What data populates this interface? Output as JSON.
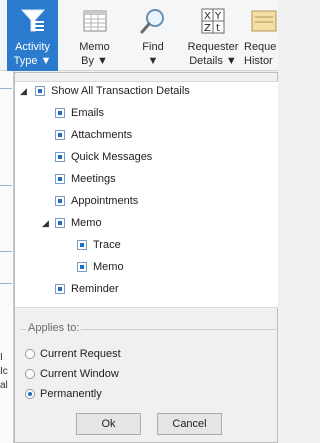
{
  "ribbon": {
    "buttons": [
      {
        "line1": "Activity",
        "line2": "Type ▼",
        "icon": "funnel-icon",
        "active": true
      },
      {
        "line1": "Memo",
        "line2": "By ▼",
        "icon": "memo-grid-icon"
      },
      {
        "line1": "Find",
        "line2": "▼",
        "icon": "magnifier-icon"
      },
      {
        "line1": "Requester",
        "line2": "Details ▼",
        "icon": "xyz-sort-icon"
      },
      {
        "line1": "Reque",
        "line2": "Histor",
        "icon": "history-icon"
      }
    ]
  },
  "background": {
    "texts": [
      "I",
      "Ic",
      "al"
    ]
  },
  "tree": {
    "root": "Show All Transaction Details",
    "items": [
      "Emails",
      "Attachments",
      "Quick Messages",
      "Meetings",
      "Appointments"
    ],
    "memo": {
      "label": "Memo",
      "children": [
        "Trace",
        "Memo"
      ]
    },
    "last": "Reminder"
  },
  "applies_to": {
    "title": "Applies to:",
    "options": [
      "Current Request",
      "Current Window",
      "Permanently"
    ],
    "selected_index": 2
  },
  "buttons": {
    "ok": "Ok",
    "cancel": "Cancel"
  },
  "colors": {
    "accent": "#2a7bcd",
    "check": "#1f6fc5"
  }
}
